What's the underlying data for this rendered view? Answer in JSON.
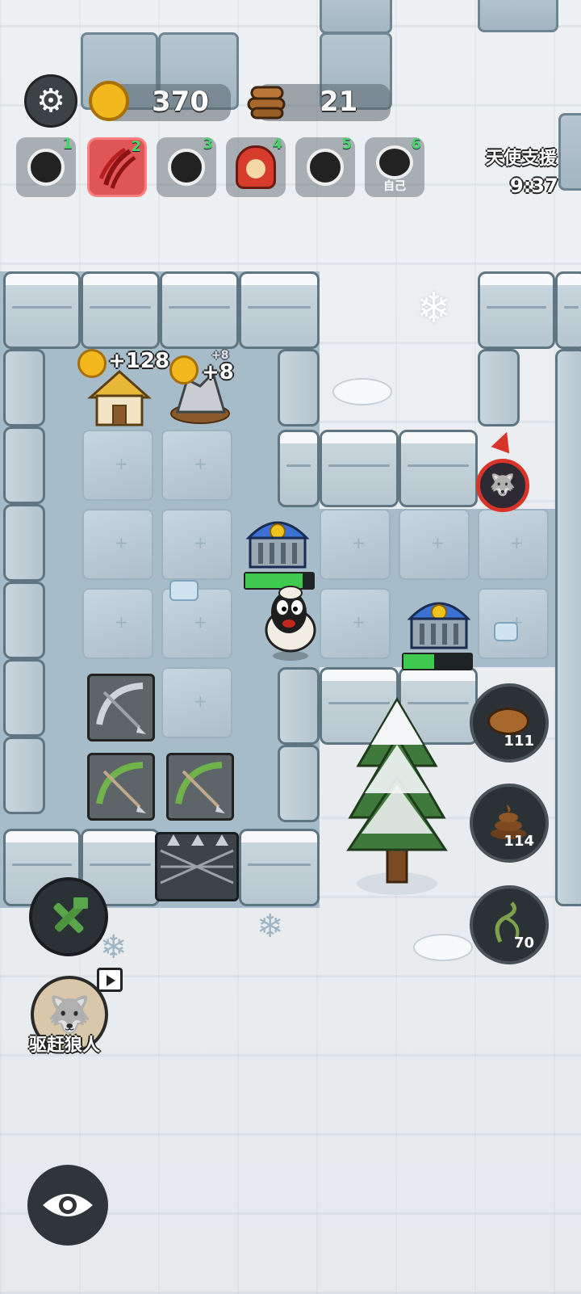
{
  "hud": {
    "coins": "370",
    "wood": "21"
  },
  "players": [
    {
      "num": "1",
      "sub": ""
    },
    {
      "num": "2",
      "sub": ""
    },
    {
      "num": "3",
      "sub": ""
    },
    {
      "num": "4",
      "sub": ""
    },
    {
      "num": "5",
      "sub": ""
    },
    {
      "num": "6",
      "sub": "自己"
    }
  ],
  "event": {
    "title": "天使支援",
    "timer": "9:37"
  },
  "field": {
    "hut_income": "+128",
    "mine_income": "+8",
    "mine_income_ghost": "+8",
    "bank1_hp_fraction": 0.85,
    "bank2_hp_fraction": 0.45
  },
  "resources": {
    "pig": "111",
    "poop": "114",
    "vine": "70"
  },
  "actions": {
    "drive_wolf": "驱赶狼人"
  },
  "colors": {
    "accent_red": "#e05555",
    "player_num_green": "#4cd46b",
    "hp_green": "#3ec94f"
  }
}
